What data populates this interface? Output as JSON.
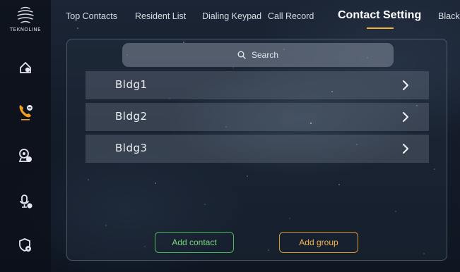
{
  "brand": {
    "name": "TEKNOLINE"
  },
  "sidebar": {
    "items": [
      {
        "icon": "home-icon"
      },
      {
        "icon": "phone-icon",
        "active": true
      },
      {
        "icon": "camera-icon"
      },
      {
        "icon": "microphone-icon"
      },
      {
        "icon": "shield-settings-icon"
      }
    ],
    "active_color": "#f0a020"
  },
  "tabs": [
    {
      "label": "Top Contacts"
    },
    {
      "label": "Resident List"
    },
    {
      "label": "Dialing Keypad"
    },
    {
      "label": "Call Record"
    },
    {
      "label": "Contact Setting",
      "active": true
    },
    {
      "label": "Black"
    }
  ],
  "search": {
    "placeholder": "Search"
  },
  "contacts": [
    {
      "label": "Bldg1"
    },
    {
      "label": "Bldg2"
    },
    {
      "label": "Bldg3"
    }
  ],
  "actions": {
    "add_contact": "Add contact",
    "add_group": "Add group"
  },
  "colors": {
    "accent": "#f0b33b",
    "add_contact": "#4fb85a",
    "add_group": "#d99a2c"
  }
}
